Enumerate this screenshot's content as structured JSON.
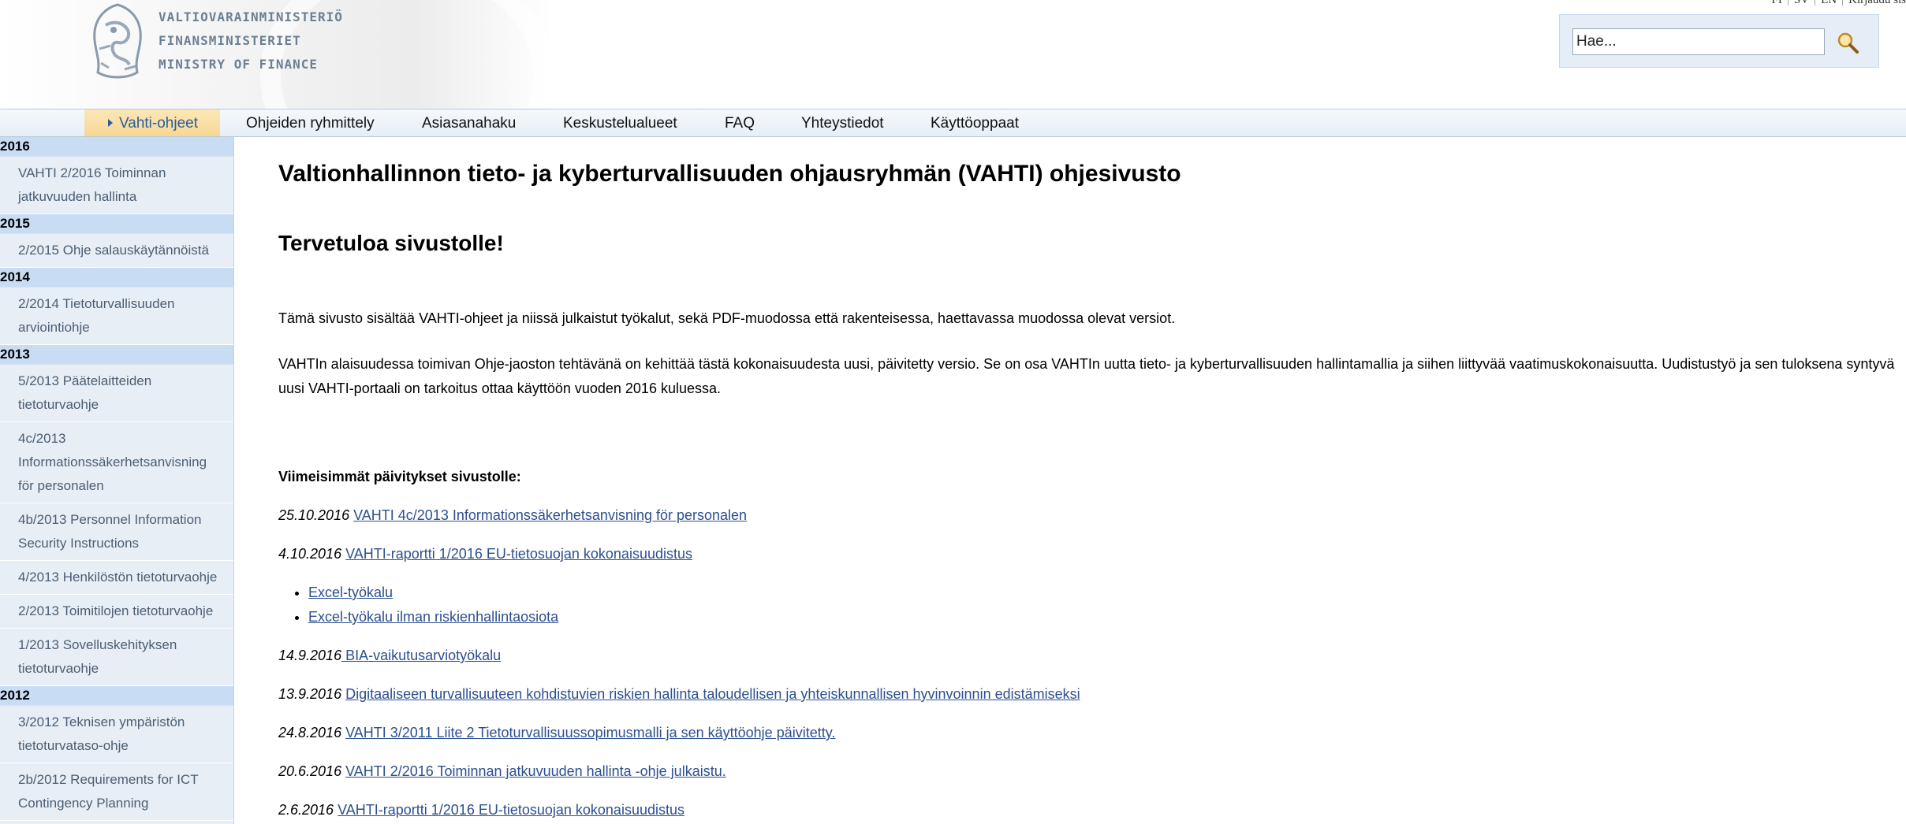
{
  "header": {
    "ministry_fi": "VALTIOVARAINMINISTERIÖ",
    "ministry_sv": "FINANSMINISTERIET",
    "ministry_en": "MINISTRY OF FINANCE",
    "crest_icon": "lion-crest-icon",
    "languages": [
      "FI",
      "SV",
      "EN"
    ],
    "login_label": "Kirjaudu sis",
    "search": {
      "placeholder": "Hae...",
      "value": "Hae...",
      "icon": "magnifier-icon"
    }
  },
  "nav": {
    "items": [
      {
        "label": "Vahti-ohjeet",
        "active": true
      },
      {
        "label": "Ohjeiden ryhmittely"
      },
      {
        "label": "Asiasanahaku"
      },
      {
        "label": "Keskustelualueet"
      },
      {
        "label": "FAQ"
      },
      {
        "label": "Yhteystiedot"
      },
      {
        "label": "Käyttöoppaat"
      }
    ]
  },
  "sidebar": {
    "groups": [
      {
        "year": "2016",
        "items": [
          "VAHTI 2/2016 Toiminnan jatkuvuuden hallinta"
        ]
      },
      {
        "year": "2015",
        "items": [
          "2/2015 Ohje salauskäytännöistä"
        ]
      },
      {
        "year": "2014",
        "items": [
          "2/2014 Tietoturvallisuuden arviointiohje"
        ]
      },
      {
        "year": "2013",
        "items": [
          "5/2013 Päätelaitteiden tietoturvaohje",
          "4c/2013 Informationssäkerhetsanvisning för personalen",
          "4b/2013 Personnel Information Security Instructions",
          "4/2013 Henkilöstön tietoturvaohje",
          "2/2013 Toimitilojen tietoturvaohje",
          "1/2013 Sovelluskehityksen tietoturvaohje"
        ]
      },
      {
        "year": "2012",
        "items": [
          "3/2012 Teknisen ympäristön tietoturvataso-ohje",
          "2b/2012 Requirements for ICT Contingency Planning"
        ]
      }
    ]
  },
  "main": {
    "title": "Valtionhallinnon tieto- ja kyberturvallisuuden ohjausryhmän (VAHTI) ohjesivusto",
    "welcome": "Tervetuloa sivustolle!",
    "intro1": "Tämä sivusto sisältää VAHTI-ohjeet ja niissä julkaistut työkalut, sekä PDF-muodossa että rakenteisessa, haettavassa muodossa olevat versiot.",
    "intro2": "VAHTIn alaisuudessa toimivan Ohje-jaoston tehtävänä on kehittää tästä kokonaisuudesta uusi, päivitetty versio. Se on osa VAHTIn uutta tieto- ja kyberturvallisuuden hallintamallia ja siihen liittyvää vaatimuskokonaisuutta. Uudistustyö ja sen tuloksena syntyvä uusi VAHTI-portaali on tarkoitus ottaa käyttöön vuoden 2016 kuluessa.",
    "updates_heading": "Viimeisimmät päivitykset sivustolle:",
    "updates": [
      {
        "date": "25.10.2016",
        "link": "VAHTI 4c/2013 Informationssäkerhetsanvisning för personalen"
      },
      {
        "date": "4.10.2016",
        "link": "VAHTI-raportti 1/2016 EU-tietosuojan kokonaisuudistus",
        "sublinks": [
          "Excel-työkalu",
          "Excel-työkalu ilman riskienhallintaosiota"
        ]
      },
      {
        "date": "14.9.2016",
        "link": " BIA-vaikutusarviotyökalu"
      },
      {
        "date": "13.9.2016",
        "link": "Digitaaliseen turvallisuuteen kohdistuvien riskien hallinta taloudellisen ja yhteiskunnallisen hyvinvoinnin edistämiseksi"
      },
      {
        "date": "24.8.2016",
        "link": "VAHTI 3/2011 Liite 2 Tietoturvallisuussopimusmalli ja sen käyttöohje päivitetty."
      },
      {
        "date": "20.6.2016",
        "link": "VAHTI 2/2016 Toiminnan jatkuvuuden hallinta -ohje julkaistu."
      },
      {
        "date": "2.6.2016",
        "link": "VAHTI-raportti 1/2016 EU-tietosuojan kokonaisuudistus"
      }
    ]
  }
}
